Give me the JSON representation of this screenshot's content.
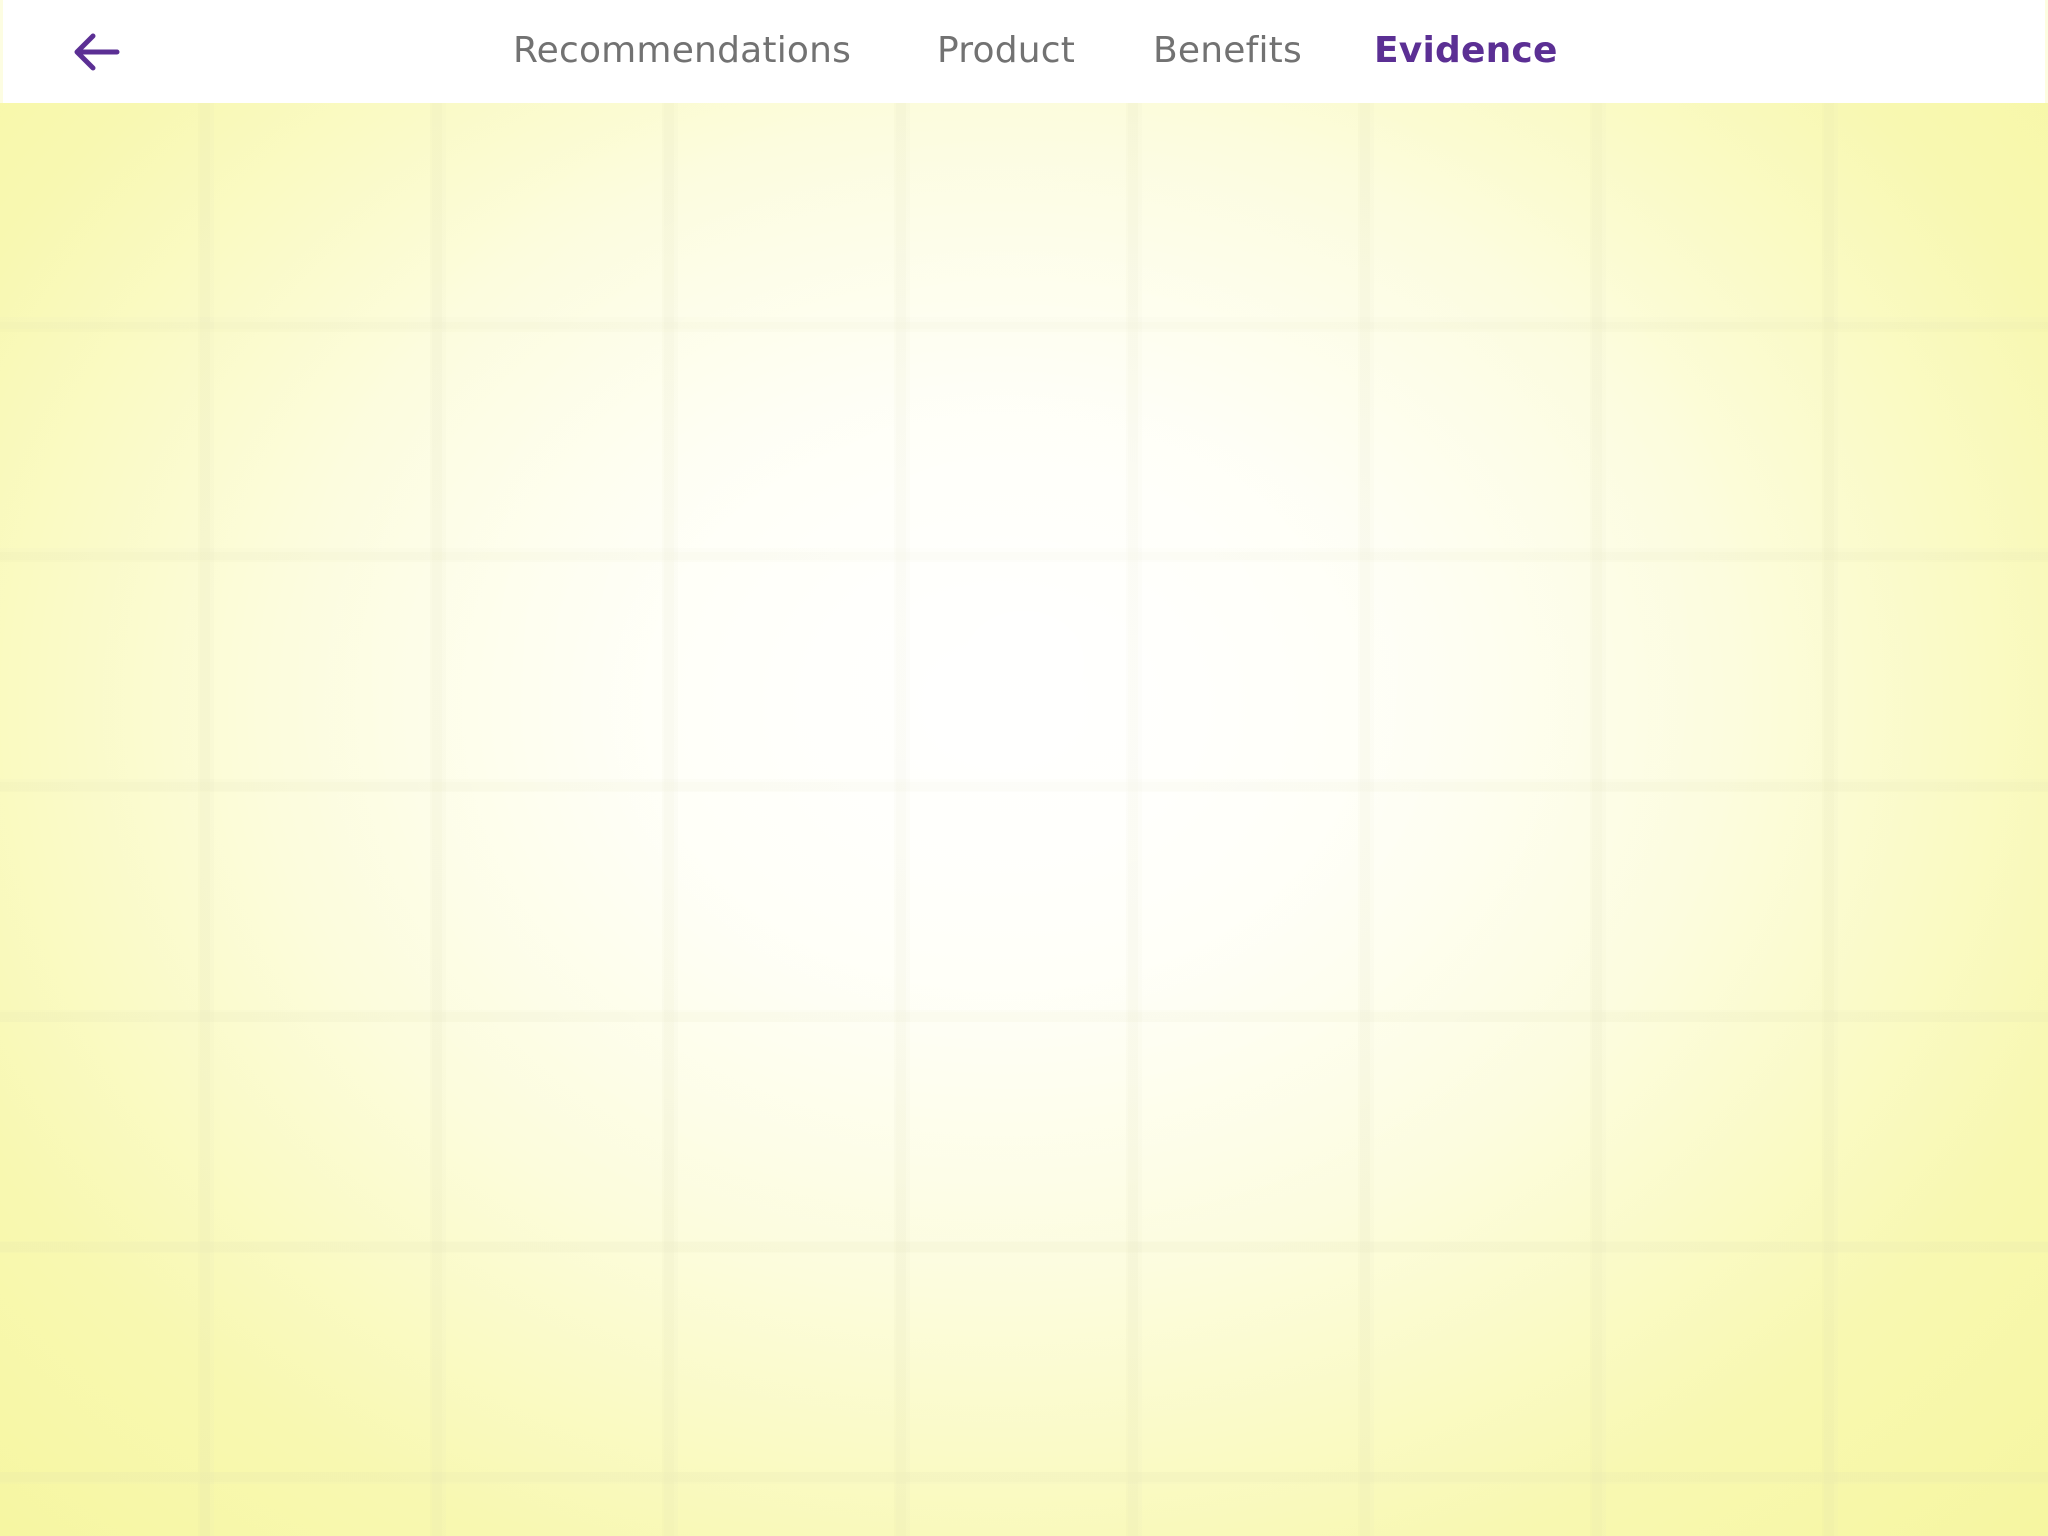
{
  "navigation": {
    "back_icon": "arrow-left-icon",
    "tabs": [
      {
        "label": "Recommendations",
        "active": false
      },
      {
        "label": "Product",
        "active": false
      },
      {
        "label": "Benefits",
        "active": false
      },
      {
        "label": "Evidence",
        "active": true
      }
    ]
  },
  "colors": {
    "accent": "#5b2f94",
    "inactive_tab": "#727272",
    "background_yellow": "#f6f6a0",
    "top_bar": "#ffffff"
  }
}
